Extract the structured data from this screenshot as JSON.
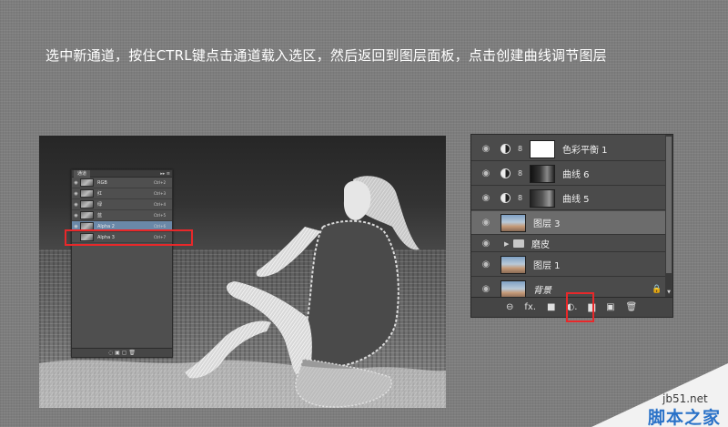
{
  "instruction": "选中新通道，按住CTRL键点击通道载入选区，然后返回到图层面板，点击创建曲线调节图层",
  "channels_panel": {
    "tab": "通道",
    "title_icons": "▸▸ ≡",
    "rows": [
      {
        "name": "RGB",
        "shortcut": "Ctrl+2"
      },
      {
        "name": "红",
        "shortcut": "Ctrl+3"
      },
      {
        "name": "绿",
        "shortcut": "Ctrl+4"
      },
      {
        "name": "蓝",
        "shortcut": "Ctrl+5"
      },
      {
        "name": "Alpha 2",
        "shortcut": "Ctrl+6"
      },
      {
        "name": "Alpha 3",
        "shortcut": "Ctrl+7"
      }
    ],
    "bottom_icons": "◌ ▣ ▢ 🗑"
  },
  "layers_panel": {
    "rows": [
      {
        "name": "色彩平衡 1",
        "type": "adjustment"
      },
      {
        "name": "曲线 6",
        "type": "adjustment"
      },
      {
        "name": "曲线 5",
        "type": "adjustment"
      },
      {
        "name": "图层 3",
        "type": "pixel"
      },
      {
        "name": "磨皮",
        "type": "group"
      },
      {
        "name": "图层 1",
        "type": "pixel"
      },
      {
        "name": "背景",
        "type": "background"
      }
    ],
    "bottom_icons": {
      "link": "⊖",
      "fx": "fx.",
      "mask": "■",
      "adjustment": "◐.",
      "group": "▆",
      "new": "▣",
      "delete": "🗑"
    }
  },
  "watermark": {
    "url": "jb51.net",
    "name": "脚本之家"
  }
}
